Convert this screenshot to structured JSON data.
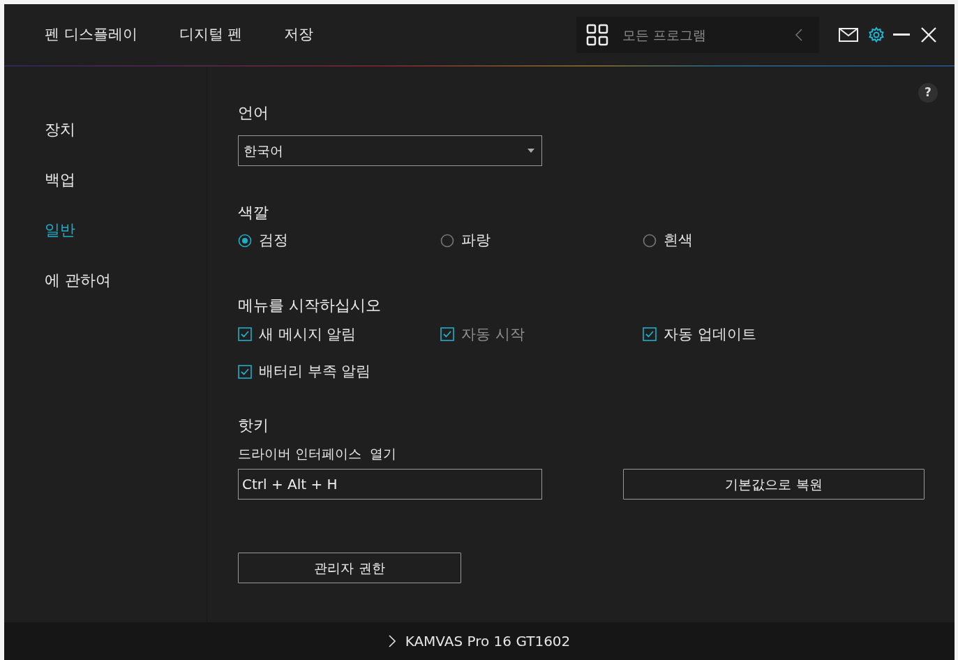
{
  "top_tabs": [
    {
      "label": "펜 디스플레이"
    },
    {
      "label": "디지털 펜"
    },
    {
      "label": "저장"
    }
  ],
  "program_selector": {
    "placeholder": "모든 프로그램"
  },
  "sidebar": {
    "items": [
      {
        "label": "장치",
        "selected": false
      },
      {
        "label": "백업",
        "selected": false
      },
      {
        "label": "일반",
        "selected": true
      },
      {
        "label": "에 관하여",
        "selected": false
      }
    ]
  },
  "help_button": "?",
  "language": {
    "title": "언어",
    "value": "한국어"
  },
  "color": {
    "title": "색깔",
    "options": [
      {
        "label": "검정",
        "selected": true
      },
      {
        "label": "파랑",
        "selected": false
      },
      {
        "label": "흰색",
        "selected": false
      }
    ]
  },
  "startup": {
    "title": "메뉴를 시작하십시오",
    "options": [
      {
        "label": "새 메시지 알림",
        "checked": true,
        "disabled": false
      },
      {
        "label": "자동 시작",
        "checked": true,
        "disabled": true
      },
      {
        "label": "자동 업데이트",
        "checked": true,
        "disabled": false
      },
      {
        "label": "배터리 부족 알림",
        "checked": true,
        "disabled": false
      }
    ]
  },
  "hotkey": {
    "title": "핫키",
    "label": "드라이버 인터페이스  열기",
    "value": "Ctrl + Alt + H",
    "reset_button": "기본값으로 복원"
  },
  "admin_button": "관리자 권한",
  "status_bar": {
    "device": "KAMVAS Pro 16 GT1602"
  }
}
